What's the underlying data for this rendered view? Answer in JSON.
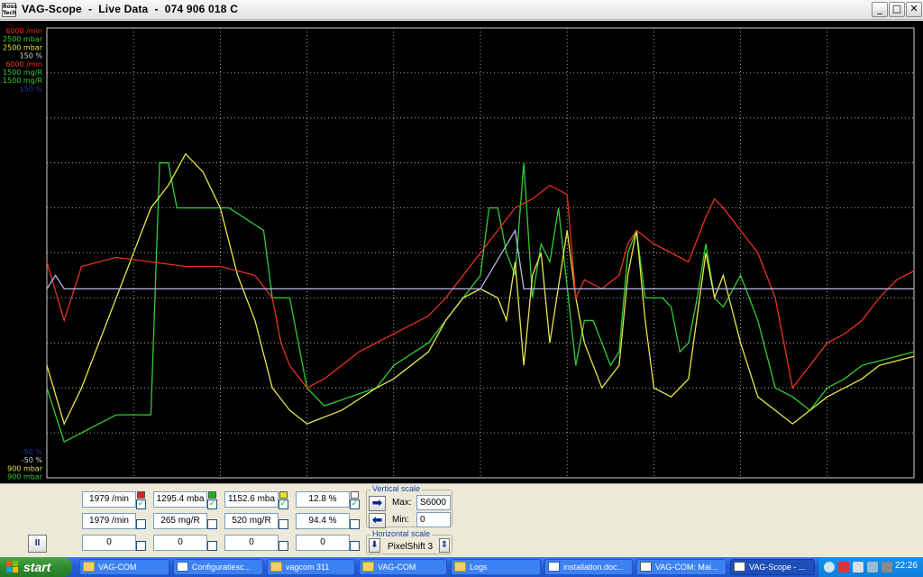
{
  "window": {
    "title": "VAG-Scope  -  Live Data  -  074 906 018 C",
    "icon_text": "Ross Tech",
    "controls": {
      "minimize": "_",
      "maximize": "□",
      "close": "✕"
    }
  },
  "scope": {
    "top_scale_labels": [
      {
        "text": "6000 /min",
        "color": "#e8321e"
      },
      {
        "text": "2500 mbar",
        "color": "#33cc33"
      },
      {
        "text": "2500 mbar",
        "color": "#e6e64a"
      },
      {
        "text": "150 %",
        "color": "#d8d8d8"
      },
      {
        "text": "6000 /min",
        "color": "#e8321e"
      },
      {
        "text": "1500 mg/R",
        "color": "#33cc33"
      },
      {
        "text": "1500 mg/R",
        "color": "#33cc33"
      },
      {
        "text": "150 %",
        "color": "#2238a0"
      }
    ],
    "bottom_scale_labels": [
      {
        "text": "-50 %",
        "color": "#2238a0"
      },
      {
        "text": "-50 %",
        "color": "#d8d8d8"
      },
      {
        "text": "900 mbar",
        "color": "#e6e64a"
      },
      {
        "text": "900 mbar",
        "color": "#33cc33"
      }
    ]
  },
  "chart_data": {
    "type": "line",
    "grid": true,
    "ylim": [
      0,
      100
    ],
    "series": [
      {
        "color": "#33cc33",
        "points": [
          [
            0,
            20
          ],
          [
            2,
            8
          ],
          [
            6,
            12
          ],
          [
            8,
            14
          ],
          [
            12,
            14
          ],
          [
            13,
            70
          ],
          [
            14,
            70
          ],
          [
            15,
            60
          ],
          [
            20,
            60
          ],
          [
            21,
            60
          ],
          [
            25,
            55
          ],
          [
            26,
            40
          ],
          [
            28,
            40
          ],
          [
            30,
            20
          ],
          [
            32,
            16
          ],
          [
            38,
            20
          ],
          [
            40,
            25
          ],
          [
            44,
            30
          ],
          [
            46,
            35
          ],
          [
            48,
            40
          ],
          [
            50,
            45
          ],
          [
            51,
            60
          ],
          [
            52,
            60
          ],
          [
            53,
            50
          ],
          [
            54,
            45
          ],
          [
            55,
            70
          ],
          [
            56,
            40
          ],
          [
            57,
            52
          ],
          [
            58,
            48
          ],
          [
            59,
            60
          ],
          [
            61,
            25
          ],
          [
            62,
            35
          ],
          [
            63,
            35
          ],
          [
            64,
            30
          ],
          [
            65,
            25
          ],
          [
            66,
            28
          ],
          [
            67,
            50
          ],
          [
            68,
            55
          ],
          [
            69,
            40
          ],
          [
            71,
            40
          ],
          [
            72,
            38
          ],
          [
            73,
            28
          ],
          [
            74,
            30
          ],
          [
            75,
            40
          ],
          [
            76,
            52
          ],
          [
            77,
            40
          ],
          [
            78,
            38
          ],
          [
            80,
            45
          ],
          [
            82,
            35
          ],
          [
            84,
            20
          ],
          [
            86,
            18
          ],
          [
            88,
            15
          ],
          [
            90,
            20
          ],
          [
            92,
            22
          ],
          [
            94,
            25
          ],
          [
            96,
            26
          ],
          [
            98,
            27
          ],
          [
            100,
            28
          ]
        ]
      },
      {
        "color": "#e6e64a",
        "points": [
          [
            0,
            25
          ],
          [
            2,
            12
          ],
          [
            4,
            20
          ],
          [
            8,
            40
          ],
          [
            12,
            60
          ],
          [
            14,
            65
          ],
          [
            16,
            72
          ],
          [
            18,
            68
          ],
          [
            20,
            60
          ],
          [
            22,
            45
          ],
          [
            24,
            35
          ],
          [
            26,
            20
          ],
          [
            28,
            15
          ],
          [
            30,
            12
          ],
          [
            34,
            15
          ],
          [
            38,
            20
          ],
          [
            40,
            22
          ],
          [
            42,
            25
          ],
          [
            44,
            28
          ],
          [
            46,
            35
          ],
          [
            48,
            40
          ],
          [
            50,
            42
          ],
          [
            52,
            40
          ],
          [
            53,
            35
          ],
          [
            54,
            48
          ],
          [
            55,
            25
          ],
          [
            56,
            45
          ],
          [
            57,
            50
          ],
          [
            58,
            30
          ],
          [
            60,
            55
          ],
          [
            61,
            40
          ],
          [
            62,
            30
          ],
          [
            63,
            25
          ],
          [
            64,
            20
          ],
          [
            66,
            25
          ],
          [
            67,
            45
          ],
          [
            68,
            55
          ],
          [
            69,
            35
          ],
          [
            70,
            20
          ],
          [
            72,
            18
          ],
          [
            74,
            22
          ],
          [
            76,
            50
          ],
          [
            77,
            40
          ],
          [
            78,
            45
          ],
          [
            80,
            30
          ],
          [
            82,
            18
          ],
          [
            84,
            15
          ],
          [
            86,
            12
          ],
          [
            88,
            15
          ],
          [
            90,
            18
          ],
          [
            92,
            20
          ],
          [
            94,
            22
          ],
          [
            96,
            25
          ],
          [
            98,
            26
          ],
          [
            100,
            27
          ]
        ]
      },
      {
        "color": "#e8321e",
        "points": [
          [
            0,
            48
          ],
          [
            2,
            35
          ],
          [
            4,
            47
          ],
          [
            8,
            49
          ],
          [
            12,
            48
          ],
          [
            16,
            47
          ],
          [
            20,
            47
          ],
          [
            22,
            46
          ],
          [
            24,
            45
          ],
          [
            26,
            40
          ],
          [
            27,
            30
          ],
          [
            28,
            25
          ],
          [
            30,
            20
          ],
          [
            32,
            22
          ],
          [
            34,
            25
          ],
          [
            36,
            28
          ],
          [
            40,
            32
          ],
          [
            44,
            36
          ],
          [
            46,
            40
          ],
          [
            48,
            45
          ],
          [
            50,
            50
          ],
          [
            52,
            55
          ],
          [
            54,
            60
          ],
          [
            56,
            62
          ],
          [
            58,
            65
          ],
          [
            60,
            63
          ],
          [
            61,
            40
          ],
          [
            62,
            44
          ],
          [
            64,
            42
          ],
          [
            66,
            45
          ],
          [
            67,
            52
          ],
          [
            68,
            55
          ],
          [
            70,
            52
          ],
          [
            72,
            50
          ],
          [
            74,
            48
          ],
          [
            76,
            58
          ],
          [
            77,
            62
          ],
          [
            78,
            60
          ],
          [
            80,
            55
          ],
          [
            82,
            50
          ],
          [
            84,
            40
          ],
          [
            86,
            20
          ],
          [
            88,
            25
          ],
          [
            90,
            30
          ],
          [
            92,
            32
          ],
          [
            94,
            35
          ],
          [
            96,
            40
          ],
          [
            98,
            44
          ],
          [
            100,
            46
          ]
        ]
      },
      {
        "color": "#b8b8e8",
        "points": [
          [
            0,
            42
          ],
          [
            1,
            45
          ],
          [
            2,
            42
          ],
          [
            10,
            42
          ],
          [
            20,
            42
          ],
          [
            30,
            42
          ],
          [
            40,
            42
          ],
          [
            45,
            42
          ],
          [
            50,
            42
          ],
          [
            54,
            55
          ],
          [
            55,
            42
          ],
          [
            60,
            42
          ],
          [
            70,
            42
          ],
          [
            80,
            42
          ],
          [
            90,
            42
          ],
          [
            100,
            42
          ]
        ]
      }
    ]
  },
  "values": {
    "row1": [
      "1979 /min",
      "1295.4 mba",
      "1152.6 mba",
      "12.8 %"
    ],
    "row2": [
      "1979 /min",
      "265 mg/R",
      "520 mg/R",
      "94.4 %"
    ],
    "row3": [
      "0",
      "0",
      "0",
      "0"
    ],
    "row1_swatches": [
      "#e02020",
      "#1fb21f",
      "#e6e61e",
      "#ffffff"
    ],
    "row1_checked": [
      true,
      true,
      true,
      true
    ],
    "row2_checked": [
      false,
      false,
      false,
      false
    ],
    "row3_checked": [
      false,
      false,
      false,
      false
    ]
  },
  "vertical_scale": {
    "title": "Vertical scale",
    "max_label": "Max:",
    "max_value": "S6000",
    "min_label": "Min:",
    "min_value": "0",
    "right_arrow": "➡",
    "left_arrow": "⬅"
  },
  "horizontal_scale": {
    "title": "Horizontal scale",
    "value": "PixelShift 3",
    "down_arrow": "⬇",
    "updown_arrow": "⇕"
  },
  "pause_label": "II",
  "taskbar": {
    "start_label": "start",
    "tasks": [
      {
        "label": "VAG-COM",
        "icon": "folder",
        "active": false
      },
      {
        "label": "Configuratiesc...",
        "icon": "docicon",
        "active": false
      },
      {
        "label": "vagcom 311",
        "icon": "folder",
        "active": false
      },
      {
        "label": "VAG-COM",
        "icon": "folder",
        "active": false
      },
      {
        "label": "Logs",
        "icon": "folder",
        "active": false
      },
      {
        "label": "installation.doc...",
        "icon": "docicon",
        "active": false
      },
      {
        "label": "VAG-COM: Mai...",
        "icon": "appicon",
        "active": false
      },
      {
        "label": "VAG-Scope - ...",
        "icon": "appicon",
        "active": true
      }
    ],
    "clock": "22:26"
  }
}
